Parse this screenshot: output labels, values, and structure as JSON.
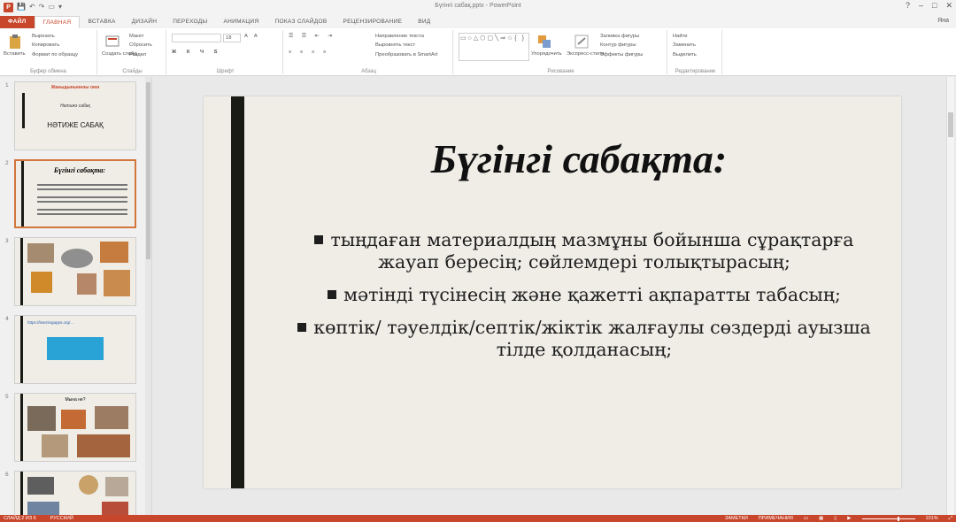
{
  "window": {
    "title": "Бүгінгі сабақ.pptx - PowerPoint",
    "user": "Яна",
    "controls": [
      "?",
      "–",
      "□",
      "✕"
    ]
  },
  "tabs": [
    {
      "label": "ФАЙЛ",
      "kind": "file"
    },
    {
      "label": "ГЛАВНАЯ",
      "kind": "active"
    },
    {
      "label": "ВСТАВКА",
      "kind": ""
    },
    {
      "label": "ДИЗАЙН",
      "kind": ""
    },
    {
      "label": "ПЕРЕХОДЫ",
      "kind": ""
    },
    {
      "label": "АНИМАЦИЯ",
      "kind": ""
    },
    {
      "label": "ПОКАЗ СЛАЙДОВ",
      "kind": ""
    },
    {
      "label": "РЕЦЕНЗИРОВАНИЕ",
      "kind": ""
    },
    {
      "label": "ВИД",
      "kind": ""
    }
  ],
  "ribbon": {
    "clipboard": {
      "paste": "Вставить",
      "cut": "Вырезать",
      "copy": "Копировать",
      "format": "Формат по образцу",
      "label": "Буфер обмена"
    },
    "slides": {
      "new": "Создать слайд",
      "layout": "Макет",
      "reset": "Сбросить",
      "section": "Раздел",
      "label": "Слайды"
    },
    "font": {
      "size": "18",
      "label": "Шрифт"
    },
    "paragraph": {
      "direction": "Направление текста",
      "align": "Выровнять текст",
      "smartart": "Преобразовать в SmartArt",
      "label": "Абзац"
    },
    "drawing": {
      "arrange": "Упорядочить",
      "styles": "Экспресс-стили",
      "fill": "Заливка фигуры",
      "outline": "Контур фигуры",
      "effects": "Эффекты фигуры",
      "label": "Рисование"
    },
    "editing": {
      "find": "Найти",
      "replace": "Заменить",
      "select": "Выделить",
      "label": "Редактирование"
    }
  },
  "thumbnails": [
    {
      "num": "1",
      "title": "Жаныдыныннлы оюн",
      "subtitle": "Натижэ сабақ",
      "heading": "НӘТИЖЕ САБАҚ"
    },
    {
      "num": "2",
      "title": "Бүгінгі сабақта:",
      "selected": true
    },
    {
      "num": "3"
    },
    {
      "num": "4",
      "link": "https://learningapps.org/..."
    },
    {
      "num": "5",
      "title": "Мына не?"
    },
    {
      "num": "6"
    }
  ],
  "slide": {
    "title": "Бүгінгі сабақта:",
    "bullets": [
      "тыңдаған материалдың мазмұны бойынша сұрақтарға жауап бересің; сөйлемдері толықтырасың;",
      "мәтінді түсінесің және қажетті ақпаратты табасың;",
      "көптік/ тәуелдік/септік/жіктік жалғаулы сөздерді ауызша тілде қолданасың;"
    ]
  },
  "status": {
    "slide_info": "СЛАЙД 2 ИЗ 6",
    "language": "РУССКИЙ",
    "notes": "ЗАМЕТКИ",
    "comments": "ПРИМЕЧАНИЯ",
    "zoom": "101%"
  },
  "colors": {
    "accent": "#c8462b",
    "slide_bg": "#efede6",
    "slide_bar": "#1b1b16"
  }
}
